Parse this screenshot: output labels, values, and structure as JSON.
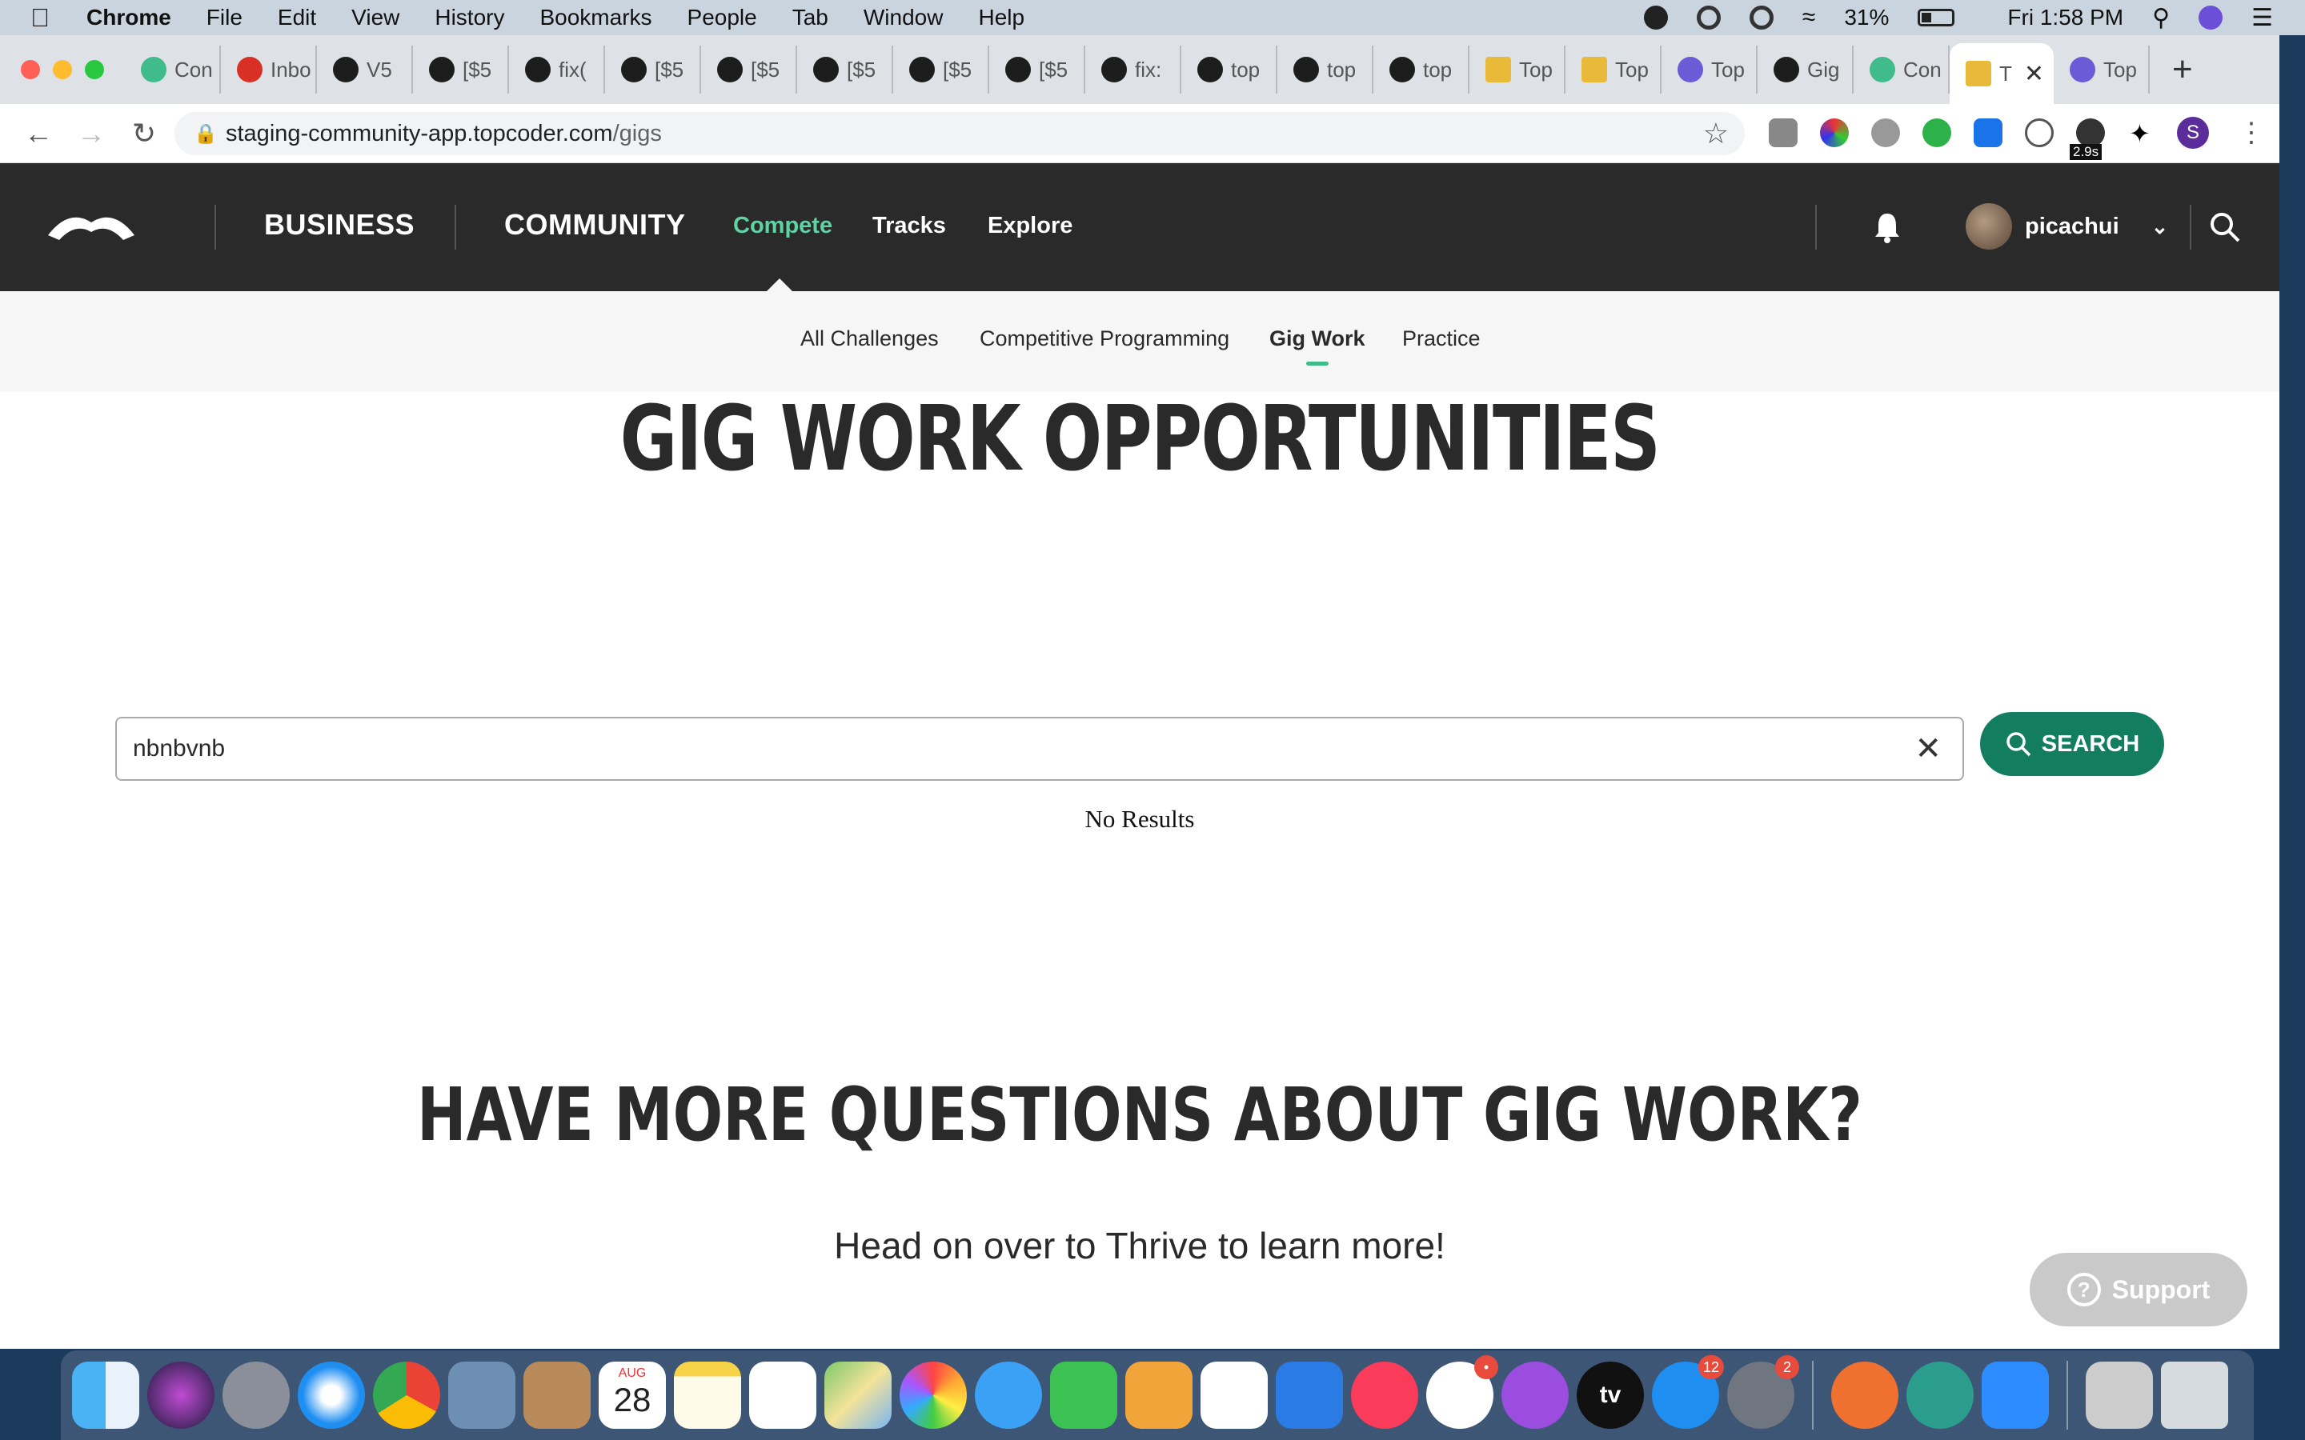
{
  "menubar": {
    "app": "Chrome",
    "items": [
      "File",
      "Edit",
      "View",
      "History",
      "Bookmarks",
      "People",
      "Tab",
      "Window",
      "Help"
    ],
    "battery": "31%",
    "clock": "Fri 1:58 PM"
  },
  "tabs": [
    {
      "label": "Con",
      "icon": "topcoder-icon"
    },
    {
      "label": "Inbo",
      "icon": "gmail-icon"
    },
    {
      "label": "V5",
      "icon": "github-icon"
    },
    {
      "label": "[$5",
      "icon": "github-icon"
    },
    {
      "label": "fix(",
      "icon": "github-icon"
    },
    {
      "label": "[$5",
      "icon": "github-icon"
    },
    {
      "label": "[$5",
      "icon": "github-icon"
    },
    {
      "label": "[$5",
      "icon": "github-icon"
    },
    {
      "label": "[$5",
      "icon": "github-icon"
    },
    {
      "label": "[$5",
      "icon": "github-icon"
    },
    {
      "label": "fix:",
      "icon": "github-icon"
    },
    {
      "label": "top",
      "icon": "github-icon"
    },
    {
      "label": "top",
      "icon": "github-icon"
    },
    {
      "label": "top",
      "icon": "github-icon"
    },
    {
      "label": "Top",
      "icon": "maps-icon"
    },
    {
      "label": "Top",
      "icon": "maps-icon"
    },
    {
      "label": "Top",
      "icon": "topcoder-wave-icon"
    },
    {
      "label": "Gig",
      "icon": "github-icon"
    },
    {
      "label": "Con",
      "icon": "topcoder-icon"
    },
    {
      "label": "T",
      "icon": "maps-icon",
      "active": true
    },
    {
      "label": "Top",
      "icon": "topcoder-wave-icon"
    }
  ],
  "omnibox": {
    "host": "staging-community-app.topcoder.com",
    "path": "/gigs"
  },
  "ext_badge": "2.9s",
  "profile_initial": "S",
  "header": {
    "business": "BUSINESS",
    "community": "COMMUNITY",
    "compete": "Compete",
    "tracks": "Tracks",
    "explore": "Explore",
    "username": "picachui"
  },
  "subnav": {
    "all": "All Challenges",
    "cp": "Competitive Programming",
    "gig": "Gig Work",
    "practice": "Practice"
  },
  "main": {
    "title": "GIG WORK OPPORTUNITIES",
    "search_value": "nbnbvnb",
    "search_button": "SEARCH",
    "no_results": "No Results",
    "questions_title": "HAVE MORE QUESTIONS ABOUT GIG WORK?",
    "questions_sub": "Head on over to Thrive to learn more!",
    "support": "Support"
  },
  "dock": {
    "calendar_month": "AUG",
    "calendar_day": "28",
    "tv_label": "tv",
    "badges": {
      "slack": "•",
      "appstore": "12",
      "settings": "2"
    }
  },
  "colors": {
    "accent_green": "#5fd3a6",
    "search_button": "#137d60",
    "header_bg": "#2a2a2a"
  }
}
